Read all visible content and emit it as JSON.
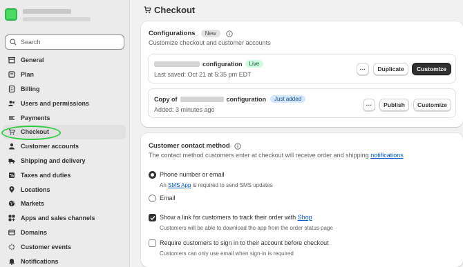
{
  "sidebar": {
    "search_placeholder": "Search",
    "items": [
      {
        "label": "General",
        "icon": "store-icon"
      },
      {
        "label": "Plan",
        "icon": "plan-icon"
      },
      {
        "label": "Billing",
        "icon": "billing-icon"
      },
      {
        "label": "Users and permissions",
        "icon": "users-icon"
      },
      {
        "label": "Payments",
        "icon": "payments-icon"
      },
      {
        "label": "Checkout",
        "icon": "cart-icon",
        "active": true
      },
      {
        "label": "Customer accounts",
        "icon": "person-icon"
      },
      {
        "label": "Shipping and delivery",
        "icon": "truck-icon"
      },
      {
        "label": "Taxes and duties",
        "icon": "taxes-icon"
      },
      {
        "label": "Locations",
        "icon": "location-icon"
      },
      {
        "label": "Markets",
        "icon": "globe-icon"
      },
      {
        "label": "Apps and sales channels",
        "icon": "apps-icon"
      },
      {
        "label": "Domains",
        "icon": "domains-icon"
      },
      {
        "label": "Customer events",
        "icon": "events-icon"
      },
      {
        "label": "Notifications",
        "icon": "bell-icon"
      }
    ]
  },
  "page": {
    "title": "Checkout"
  },
  "configurations": {
    "title": "Configurations",
    "badge": "New",
    "subtitle": "Customize checkout and customer accounts",
    "live_config": {
      "name_suffix": "configuration",
      "status": "Live",
      "saved": "Last saved: Oct 21 at 5:35 pm EDT",
      "more": "···",
      "duplicate": "Duplicate",
      "customize": "Customize"
    },
    "copy_config": {
      "prefix": "Copy of",
      "name_suffix": "configuration",
      "status": "Just added",
      "added": "Added: 3 minutes ago",
      "more": "···",
      "publish": "Publish",
      "customize": "Customize"
    }
  },
  "contact": {
    "title": "Customer contact method",
    "desc_text": "The contact method customers enter at checkout will receive order and shipping",
    "desc_link": "notifications",
    "option_phone": "Phone number or email",
    "sms_prefix": "An",
    "sms_link": "SMS App",
    "sms_suffix": "is required to send SMS updates",
    "option_email": "Email",
    "track_text": "Show a link for customers to track their order with",
    "track_link": "Shop",
    "track_help": "Customers will be able to download the app from the order status page",
    "signin_text": "Require customers to sign in to their account before checkout",
    "signin_help": "Customers can only use email when sign-in is required"
  },
  "colors": {
    "accent_green": "#2ecc40",
    "live_badge": "#cdfee1",
    "added_badge": "#d4e8ff",
    "primary_button": "#303030",
    "link": "#005bd3"
  }
}
